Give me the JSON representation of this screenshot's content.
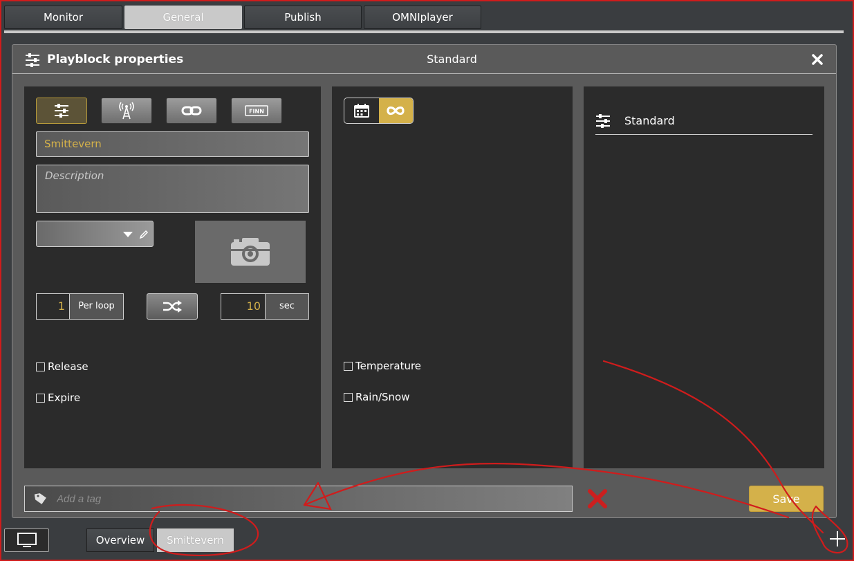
{
  "top_tabs": [
    {
      "label": "Monitor",
      "active": false
    },
    {
      "label": "General",
      "active": true
    },
    {
      "label": "Publish",
      "active": false
    },
    {
      "label": "OMNIplayer",
      "active": false
    }
  ],
  "dialog": {
    "title": "Playblock properties",
    "mode": "Standard",
    "close_icon": "close-icon",
    "left_panel": {
      "type_buttons": [
        {
          "icon": "sliders-icon",
          "selected": true
        },
        {
          "icon": "antenna-icon",
          "selected": false
        },
        {
          "icon": "link-icon",
          "selected": false
        },
        {
          "icon": "finn-icon",
          "label": "FINN",
          "selected": false
        }
      ],
      "name_value": "Smittevern",
      "description_placeholder": "Description",
      "per_loop_value": "1",
      "per_loop_unit": "Per loop",
      "duration_value": "10",
      "duration_unit": "sec",
      "checkboxes": [
        {
          "label": "Release",
          "checked": false
        },
        {
          "label": "Expire",
          "checked": false
        }
      ]
    },
    "middle_panel": {
      "toggle": [
        {
          "icon": "calendar-icon",
          "on": false
        },
        {
          "icon": "infinity-icon",
          "on": true
        }
      ],
      "checkboxes": [
        {
          "label": "Temperature",
          "checked": false
        },
        {
          "label": "Rain/Snow",
          "checked": false
        }
      ]
    },
    "right_panel": {
      "mode_label": "Standard"
    },
    "tag_placeholder": "Add a tag",
    "save_label": "Save"
  },
  "bottom": {
    "tabs": [
      {
        "label": "Overview",
        "active": false
      },
      {
        "label": "Smittevern",
        "active": true
      }
    ]
  },
  "colors": {
    "accent": "#d4b14a",
    "annotation": "#d01c1c"
  }
}
